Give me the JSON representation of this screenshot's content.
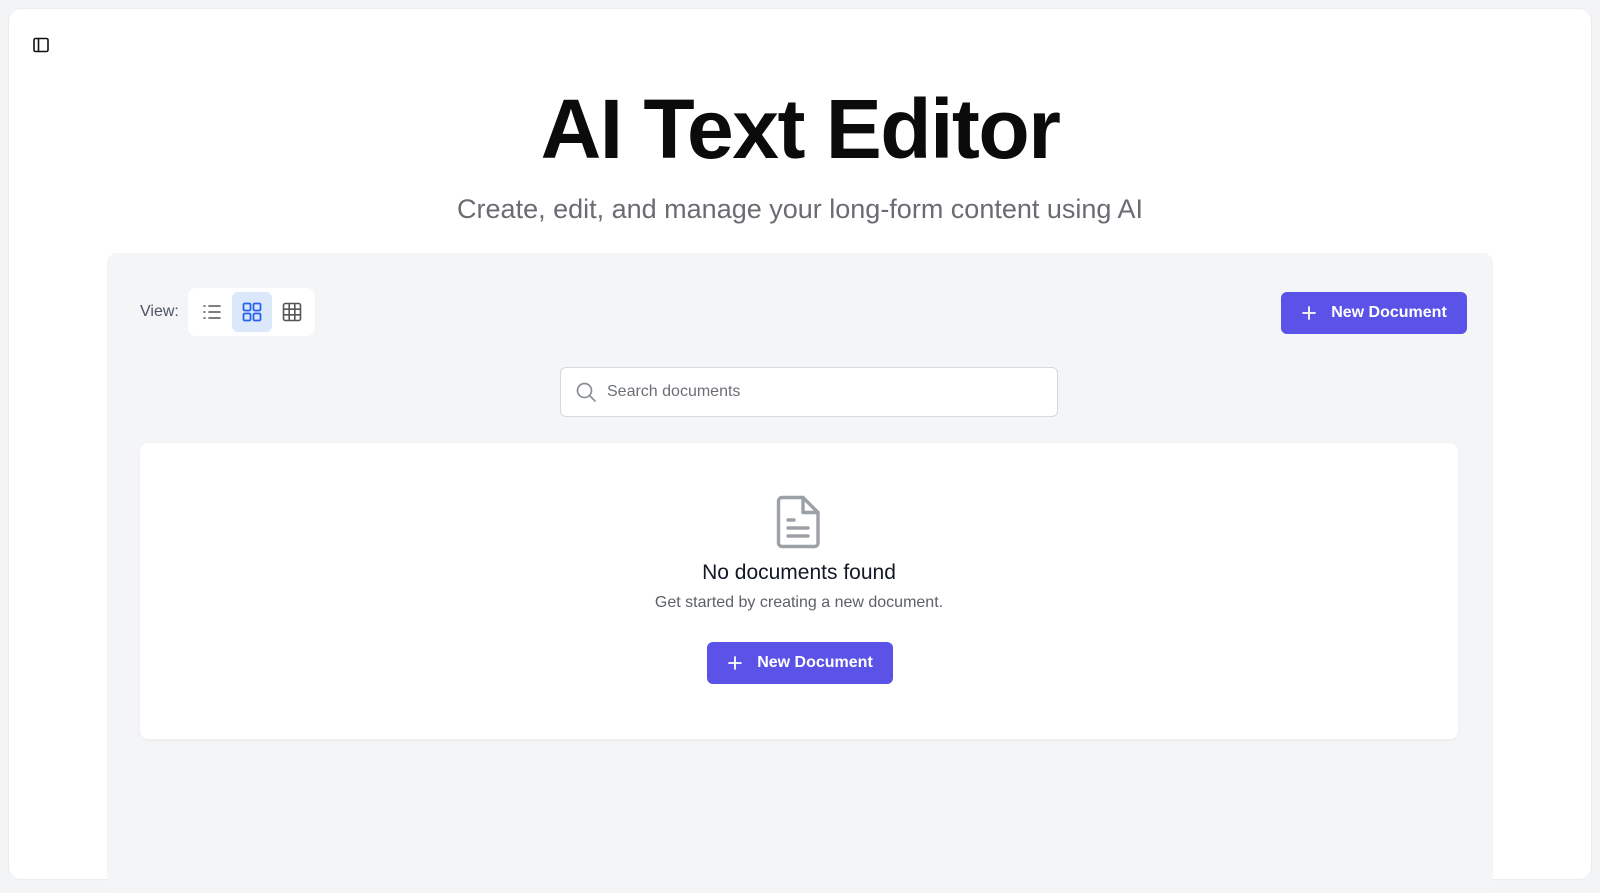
{
  "header": {
    "title": "AI Text Editor",
    "subtitle": "Create, edit, and manage your long-form content using AI"
  },
  "toolbar": {
    "view_label": "View:",
    "view_modes": [
      "list",
      "grid",
      "table"
    ],
    "active_view": "grid",
    "new_document_label": "New Document"
  },
  "search": {
    "placeholder": "Search documents",
    "value": ""
  },
  "empty_state": {
    "title": "No documents found",
    "description": "Get started by creating a new document.",
    "button_label": "New Document"
  },
  "colors": {
    "accent": "#5b52e7",
    "active_view_bg": "#dbe7fb",
    "active_view_icon": "#2563eb"
  }
}
